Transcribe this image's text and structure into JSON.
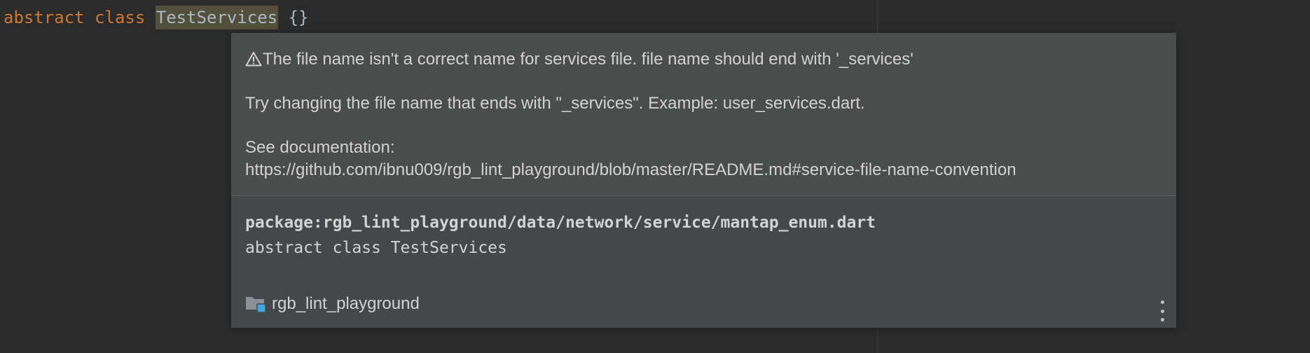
{
  "editor": {
    "code": {
      "keyword_abstract": "abstract",
      "keyword_class": "class",
      "class_name": "TestServices",
      "braces": "{}"
    }
  },
  "popup": {
    "warning_text": "The file name isn't a correct name for services file. file name should end with '_services'",
    "suggestion_text": "Try changing the file name that ends with \"_services\". Example: user_services.dart.",
    "docs_label": "See documentation:",
    "docs_url": "https://github.com/ibnu009/rgb_lint_playground/blob/master/README.md#service-file-name-convention",
    "package_path": "package:rgb_lint_playground/data/network/service/mantap_enum.dart",
    "declaration": "abstract class TestServices",
    "module_name": "rgb_lint_playground",
    "icons": {
      "warning": "warning-icon",
      "module": "folder-module-icon",
      "more": "more-vertical-icon"
    }
  },
  "colors": {
    "keyword": "#cc7832",
    "identifier": "#a9b7c6",
    "editor_bg": "#2b2b2b",
    "popup_bg": "#4b4d4d",
    "popup_footer_bg": "#45484a",
    "text": "#d2d2d2",
    "module_badge": "#3fa8e0"
  }
}
